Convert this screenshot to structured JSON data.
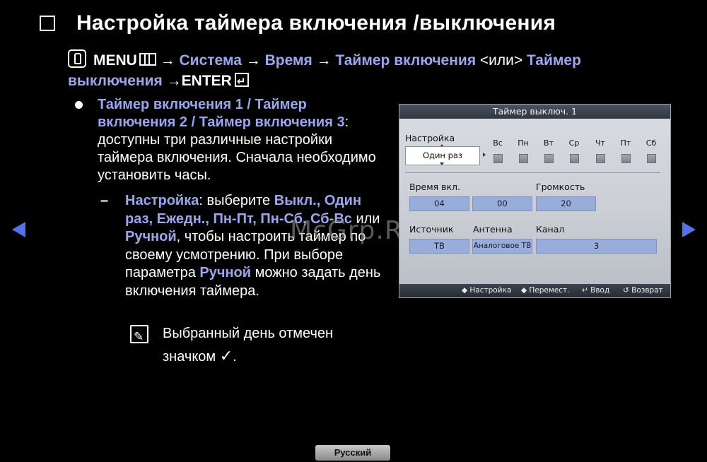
{
  "title": "Настройка таймера включения /выключения",
  "path": {
    "menu": "MENU",
    "arrow": " → ",
    "system": "Система",
    "time": "Время",
    "on_timer": "Таймер включения",
    "or": " <или> ",
    "off_timer": "Таймер выключения",
    "enter": "→ENTER"
  },
  "bullet": {
    "heading": "Таймер включения 1 / Таймер включения 2 / Таймер включения 3",
    "colon": ":",
    "text": "доступны три различные настройки таймера включения. Сначала необходимо установить часы."
  },
  "dash": {
    "dash_char": "–",
    "label": "Настройка",
    "t1": ": выберите ",
    "options": "Выкл., Один раз, Ежедн., Пн-Пт, Пн-Сб, Сб-Вс",
    "t2": " или ",
    "manual": "Ручной",
    "t3": ", чтобы настроить таймер по своему усмотрению. При выборе параметра ",
    "manual2": "Ручной",
    "t4": " можно задать день включения таймера."
  },
  "note": {
    "text": "Выбранный день отмечен значком ",
    "check": "✓",
    "end": "."
  },
  "watermark": "McGrp.Ru",
  "tv": {
    "header": "Таймер выключ. 1",
    "setup_label": "Настройка",
    "setup_value": "Один раз",
    "days": [
      "Вс",
      "Пн",
      "Вт",
      "Ср",
      "Чт",
      "Пт",
      "Сб"
    ],
    "on_time_label": "Время вкл.",
    "hour": "04",
    "minute": "00",
    "volume_label": "Громкость",
    "volume": "20",
    "source_label": "Источник",
    "source": "ТВ",
    "antenna_label": "Антенна",
    "antenna": "Аналоговое ТВ",
    "channel_label": "Канал",
    "channel": "3",
    "footer": {
      "setup": "◆ Настройка",
      "move": "◆ Перемест.",
      "enter": "↵ Ввод",
      "back": "↺ Возврат"
    }
  },
  "language": "Русский",
  "colors": {
    "accent": "#9ba7ec",
    "nav_arrow": "#5570ea"
  }
}
